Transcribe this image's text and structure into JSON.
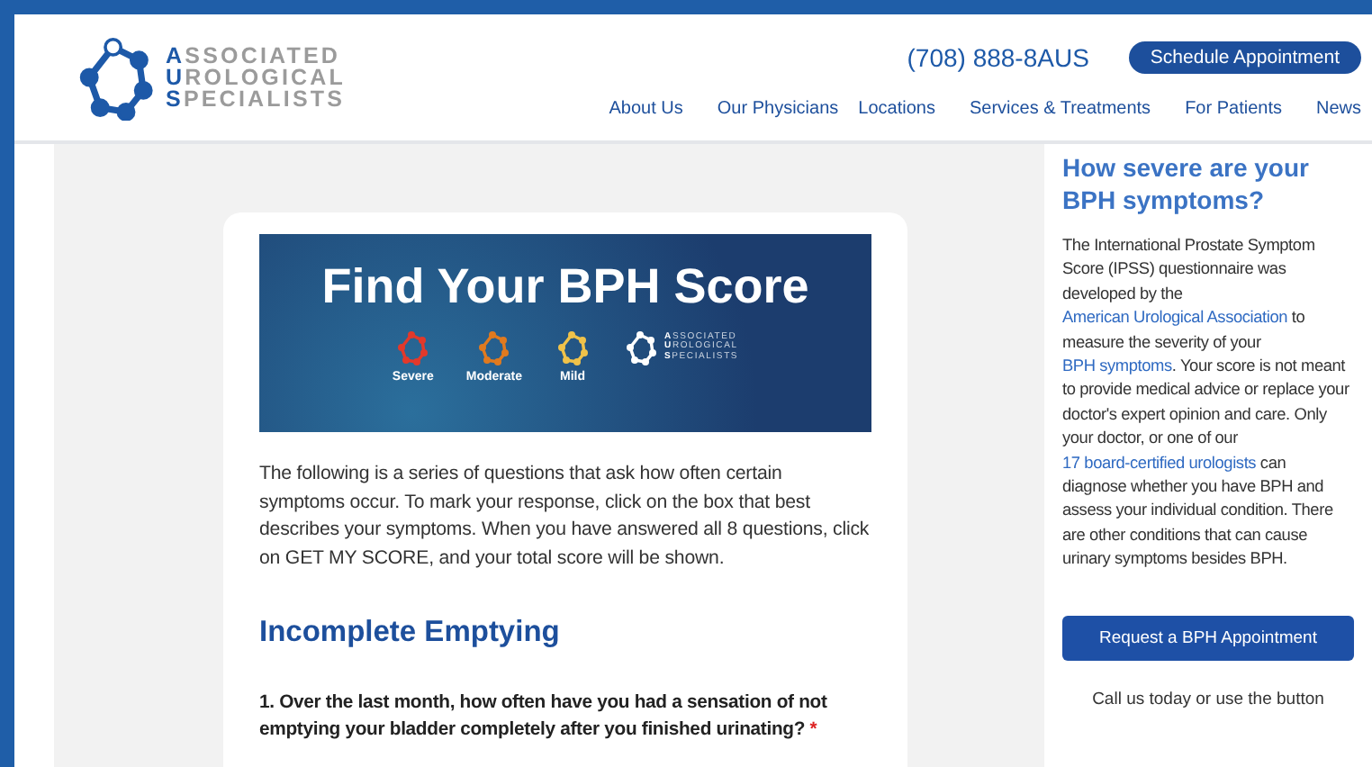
{
  "logo": {
    "lines": [
      {
        "initial": "A",
        "rest": "SSOCIATED"
      },
      {
        "initial": "U",
        "rest": "ROLOGICAL"
      },
      {
        "initial": "S",
        "rest": "PECIALISTS"
      }
    ]
  },
  "phone": "(708) 888-8AUS",
  "schedule_button": "Schedule Appointment",
  "nav": [
    "About Us",
    "Our Physicians",
    "Locations",
    "Services & Treatments",
    "For Patients",
    "News"
  ],
  "banner": {
    "title": "Find Your BPH Score",
    "levels": [
      {
        "label": "Severe",
        "color": "#e2392b"
      },
      {
        "label": "Moderate",
        "color": "#e07a1f"
      },
      {
        "label": "Mild",
        "color": "#efc24a"
      }
    ],
    "logo_lines": [
      {
        "initial": "A",
        "rest": "SSOCIATED"
      },
      {
        "initial": "U",
        "rest": "ROLOGICAL"
      },
      {
        "initial": "S",
        "rest": "PECIALISTS"
      }
    ]
  },
  "intro": "The following is a series of questions that ask how often certain symptoms occur. To mark your response, click on the box that best describes your symptoms. When you have answered all 8 questions, click on GET MY SCORE, and your total score will be shown.",
  "section_title": "Incomplete Emptying",
  "question": {
    "text": "1. Over the last month, how often have you had a sensation of not emptying your bladder completely after you finished urinating?",
    "required_mark": "*"
  },
  "sidebar": {
    "title": "How severe are your BPH symptoms?",
    "paragraph": [
      {
        "text": "The International Prostate Symptom Score (IPSS) questionnaire was developed by the ",
        "link": false
      },
      {
        "text": "American Urological Association",
        "link": true
      },
      {
        "text": " to measure the severity of your ",
        "link": false
      },
      {
        "text": "BPH symptoms",
        "link": true
      },
      {
        "text": ". Your score is not meant to provide medical advice or replace your doctor's expert opinion and care. Only your doctor, or one of our ",
        "link": false
      },
      {
        "text": "17 board-certified urologists",
        "link": true
      },
      {
        "text": " can diagnose whether you have BPH and assess your individual condition. There are other conditions that can cause urinary symptoms besides BPH.",
        "link": false
      }
    ],
    "button": "Request a BPH Appointment",
    "footer": "Call us today or use the button"
  }
}
